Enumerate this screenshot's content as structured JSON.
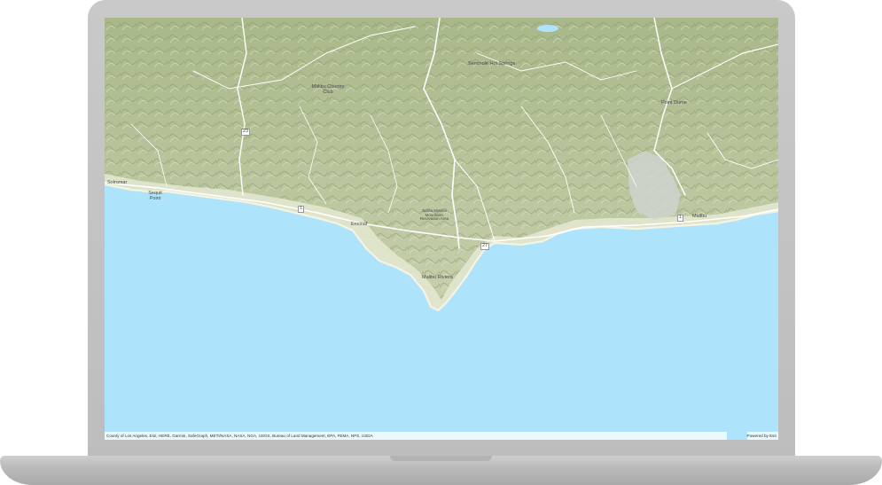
{
  "map": {
    "place_labels": {
      "solromar": "Solromar",
      "sequit_point": "Sequit Point",
      "malibu_county_club": "Malibu Country Club",
      "encinal": "Encinal",
      "malibu_riviera": "Malibu Riviera",
      "malibu": "Malibu",
      "point_dume": "Point Dume",
      "monica_mountains": "Santa Monica Mountains Recreation Area",
      "seminole": "Seminole Hot Springs"
    },
    "route_shields": {
      "r23": "23",
      "r1a": "1",
      "r1b": "1",
      "r27": "27"
    },
    "attribution": "County of Los Angeles, Esri, HERE, Garmin, SafeGraph, METI/NASA, NASA, NGA, USGS, Bureau of Land Management, EPA, FEMA, NPS, USDA",
    "powered_by": "Powered by Esri",
    "colors": {
      "water": "#aee3fc",
      "land": "#b6c39a",
      "coast": "#e8ead4",
      "roads": "#ffffff"
    }
  }
}
